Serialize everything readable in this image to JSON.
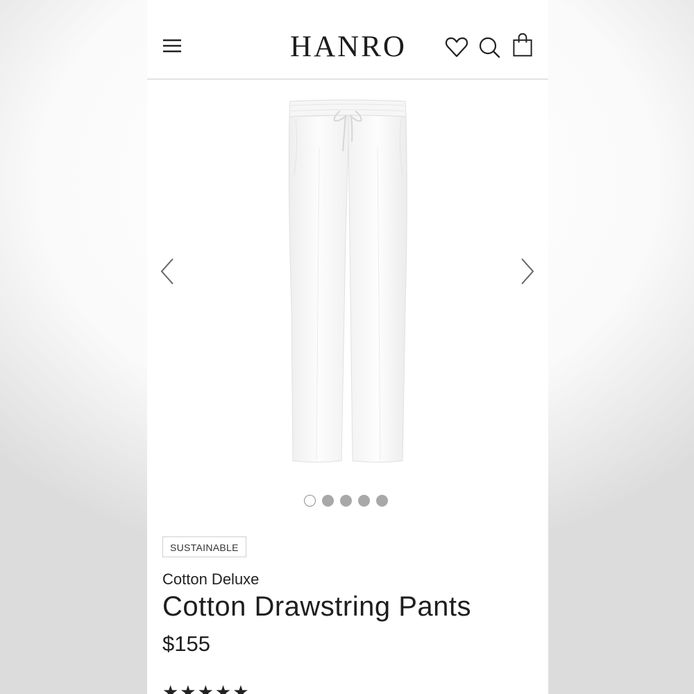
{
  "header": {
    "logo": "HANRO",
    "menu_icon": "hamburger-menu-icon",
    "wishlist_icon": "heart-icon",
    "search_icon": "search-icon",
    "bag_icon": "shopping-bag-icon"
  },
  "gallery": {
    "image": "white cotton drawstring pants",
    "prev_icon": "chevron-left-icon",
    "next_icon": "chevron-right-icon",
    "dot_count": 5,
    "active_dot": 1
  },
  "product": {
    "badge": "SUSTAINABLE",
    "collection": "Cotton Deluxe",
    "title": "Cotton Drawstring Pants",
    "price": "$155",
    "rating_glyphs": "★★★★★"
  },
  "colors": {
    "text": "#1e1e1e",
    "dot_inactive": "#a8a8a8",
    "divider": "#e3e3e3"
  }
}
